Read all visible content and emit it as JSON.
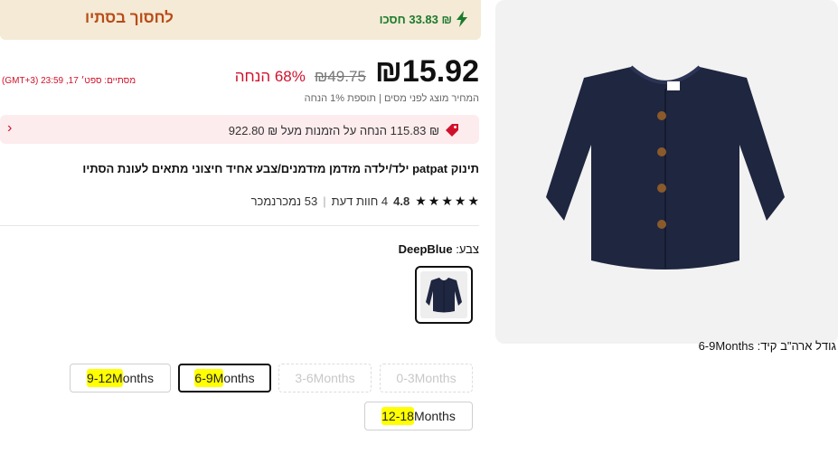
{
  "banner": {
    "savings_text": "₪ 33.83 חסכו",
    "deal_label": "לחסוך בסתיו"
  },
  "pricing": {
    "price": "₪15.92",
    "old_price": "₪49.75",
    "discount": "68% הנחה",
    "ends_text": "מסתיים: ספט׳ 17, 23:59 (GMT+3)",
    "tax_note": "המחיר מוצג לפני מסים | תוספת 1% הנחה"
  },
  "coupon": {
    "text": "₪ 115.83 הנחה על הזמנות מעל ₪ 922.80"
  },
  "product": {
    "title": "תינוק patpat ילד/ילדה מזדמן מזדמנים/צבע אחיד חיצוני מתאים לעונת הסתיו",
    "rating": "4.8",
    "reviews": "4 חוות דעת",
    "sold": "53 נמכרנמכר"
  },
  "color": {
    "label": "צבע:",
    "value": "DeepBlue"
  },
  "size": {
    "label": "גודל ארה\"ב קיד: 6-9Months",
    "options": [
      {
        "highlight": "",
        "rest": "0-3Months",
        "state": "disabled"
      },
      {
        "highlight": "",
        "rest": "3-6Months",
        "state": "disabled"
      },
      {
        "highlight": "6-9M",
        "rest": "onths",
        "state": "selected"
      },
      {
        "highlight": "9-12M",
        "rest": "onths",
        "state": "available"
      },
      {
        "highlight": "12-18",
        "rest": "Months",
        "state": "available"
      }
    ]
  },
  "colors": {
    "garment": "#1f2640",
    "discount_red": "#d0112b",
    "save_green": "#1b7a2c",
    "deal_orange": "#b84b18",
    "banner_bg": "#f4ead5",
    "highlight": "#ffff00"
  }
}
